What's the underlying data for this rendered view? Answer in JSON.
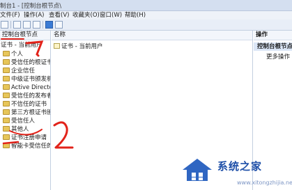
{
  "window": {
    "title": "制台1 - [控制台根节点\\"
  },
  "menu": [
    "文件(F)",
    "操作(A)",
    "查看(V)",
    "收藏夹(O)",
    "窗口(W)",
    "帮助(H)"
  ],
  "left_pane": {
    "header": "控制台根节点",
    "root": "证书 - 当前用户",
    "items": [
      "个人",
      "受信任的根证书",
      "企业信任",
      "中级证书颁发机",
      "Active Director",
      "受信任的发布者",
      "不信任的证书",
      "第三方根证书颁",
      "受信任人",
      "其他人",
      "证书注册申请",
      "智能卡受信任的"
    ]
  },
  "center_pane": {
    "column_header": "名称",
    "rows": [
      "证书 - 当前用户"
    ]
  },
  "actions_pane": {
    "header": "操作",
    "section_title": "控制台根节点",
    "more": "更多操作"
  },
  "annotations": [
    "1",
    "2"
  ],
  "watermark": {
    "brand": "系统之家",
    "url": "www.xitongzhijia.net"
  }
}
